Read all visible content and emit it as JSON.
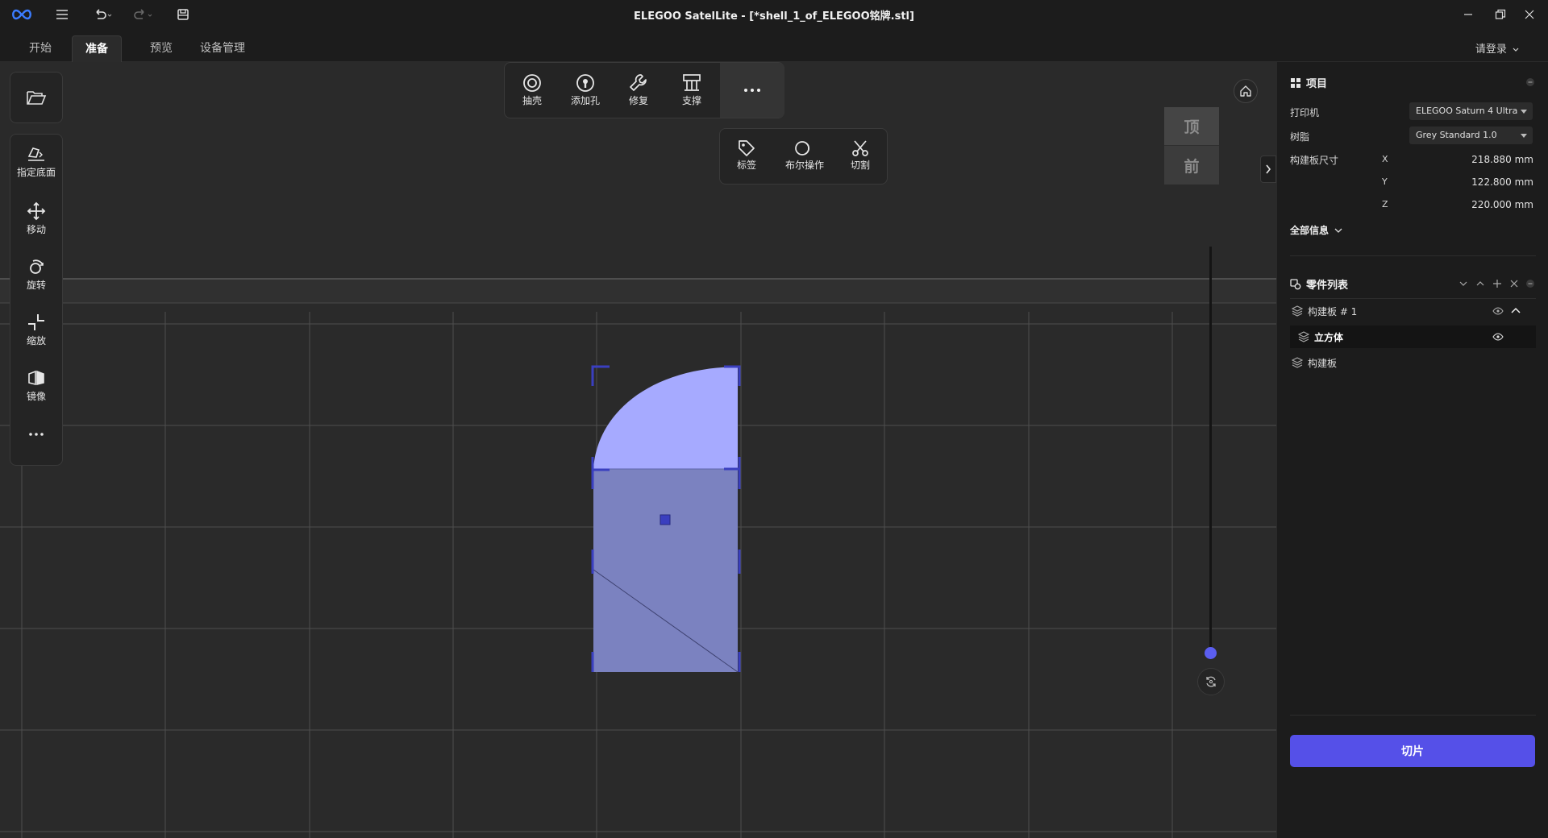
{
  "window": {
    "title": "ELEGOO SatelLite - [*shell_1_of_ELEGOO铭牌.stl]"
  },
  "tabs": [
    {
      "label": "开始"
    },
    {
      "label": "准备"
    },
    {
      "label": "预览"
    },
    {
      "label": "设备管理"
    }
  ],
  "account": {
    "login_label": "请登录"
  },
  "left_toolbar": {
    "items": [
      {
        "label": "指定底面",
        "icon": "place-on-face-icon"
      },
      {
        "label": "移动",
        "icon": "move-icon"
      },
      {
        "label": "旋转",
        "icon": "rotate-icon"
      },
      {
        "label": "缩放",
        "icon": "scale-icon"
      },
      {
        "label": "镜像",
        "icon": "mirror-icon"
      }
    ]
  },
  "top_toolbar": {
    "items": [
      {
        "label": "抽壳",
        "icon": "hollow-icon"
      },
      {
        "label": "添加孔",
        "icon": "add-hole-icon"
      },
      {
        "label": "修复",
        "icon": "repair-icon"
      },
      {
        "label": "支撑",
        "icon": "support-icon"
      }
    ],
    "more_items": [
      {
        "label": "标签",
        "icon": "label-tag-icon"
      },
      {
        "label": "布尔操作",
        "icon": "boolean-icon"
      },
      {
        "label": "切割",
        "icon": "cut-icon"
      }
    ]
  },
  "view_cube": {
    "top": "顶",
    "front": "前"
  },
  "project": {
    "title": "项目",
    "printer_label": "打印机",
    "printer_value": "ELEGOO Saturn 4 Ultra",
    "resin_label": "树脂",
    "resin_value": "Grey Standard 1.0",
    "plate_size_label": "构建板尺寸",
    "x_axis": "X",
    "x_value": "218.880 mm",
    "y_axis": "Y",
    "y_value": "122.800 mm",
    "z_axis": "Z",
    "z_value": "220.000 mm",
    "all_info_label": "全部信息"
  },
  "parts": {
    "title": "零件列表",
    "rows": [
      {
        "label": "构建板 # 1"
      },
      {
        "label": "立方体"
      },
      {
        "label": "构建板"
      }
    ]
  },
  "slice_button": {
    "label": "切片"
  },
  "colors": {
    "accent": "#5550e8",
    "model_top": "#a6aaff",
    "model_side": "#7b82c0",
    "handle": "#3a3fbf"
  }
}
